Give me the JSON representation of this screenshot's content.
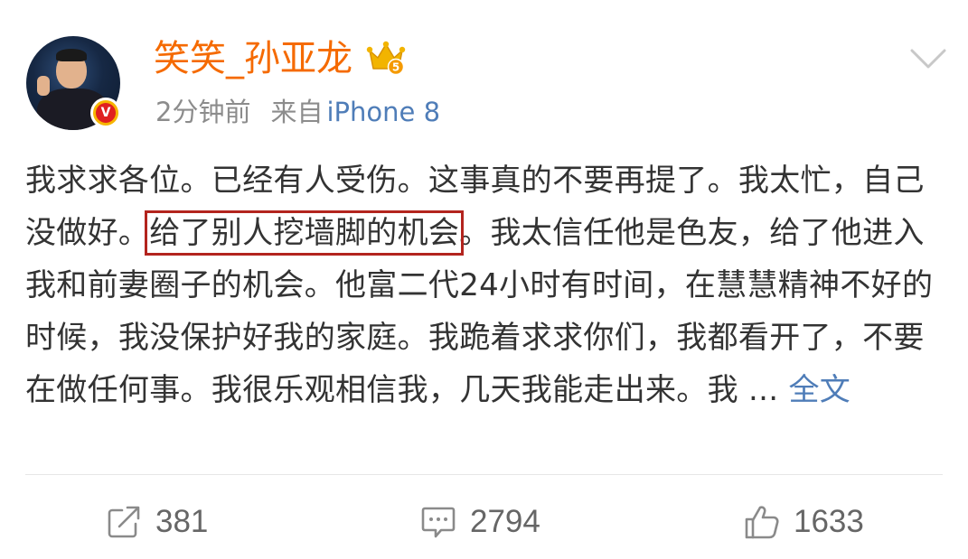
{
  "post": {
    "author": {
      "name": "笑笑_孙亚龙",
      "verified_mark": "V",
      "vip_level": "5"
    },
    "meta": {
      "time": "2分钟前",
      "source_prefix": "来自",
      "source_device": "iPhone 8"
    },
    "body": {
      "text_before": "我求求各位。已经有人受伤。这事真的不要再提了。我太忙，自己没做好。",
      "text_highlighted": "给了别人挖墙脚的机会",
      "text_after": "。我太信任他是色友，给了他进入我和前妻圈子的机会。他富二代24小时有时间，在慧慧精神不好的时候，我没保护好我的家庭。我跪着求求你们，我都看开了，不要在做任何事。我很乐观相信我，几天我能走出来。我 ... ",
      "full_text_link": "全文",
      "highlight_color": "#b3241e"
    },
    "actions": {
      "repost_count": "381",
      "comment_count": "2794",
      "like_count": "1633"
    },
    "icons": {
      "repost": "share-arrow-icon",
      "comment": "comment-bubble-icon",
      "like": "thumbs-up-icon",
      "more": "chevron-down-icon",
      "vip": "crown-icon",
      "verified": "verified-v-icon"
    },
    "colors": {
      "username": "#f56a00",
      "link": "#4f7db8",
      "meta": "#8c8c8c",
      "body_text": "#333333",
      "verified_badge": "#f7b500"
    }
  }
}
